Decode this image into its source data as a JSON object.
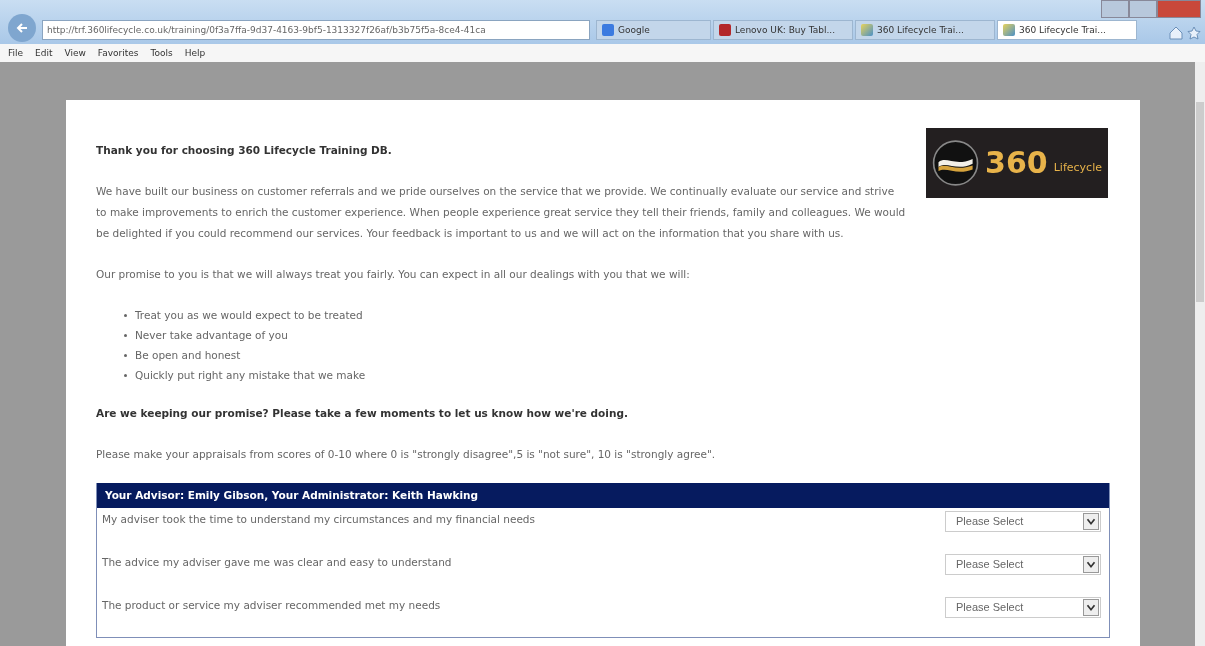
{
  "browser": {
    "address": "http://trf.360lifecycle.co.uk/training/0f3a7ffa-9d37-4163-9bf5-1313327f26af/b3b75f5a-8ce4-41ca",
    "tabs": [
      {
        "label": "Google",
        "selected": false,
        "kind": "google"
      },
      {
        "label": "Lenovo UK: Buy Tabl...",
        "selected": false,
        "kind": "lenovo"
      },
      {
        "label": "360 Lifecycle Trai...",
        "selected": false,
        "kind": "page"
      },
      {
        "label": "360 Lifecycle Trai...",
        "selected": true,
        "kind": "page"
      }
    ],
    "menu": [
      "File",
      "Edit",
      "View",
      "Favorites",
      "Tools",
      "Help"
    ]
  },
  "page": {
    "heading": "Thank you for choosing 360 Lifecycle Training DB.",
    "logo": {
      "number": "360",
      "word": "Lifecycle"
    },
    "intro": "We have built our business on customer referrals and we pride ourselves on the service that we provide. We continually evaluate our service and strive to make improvements to enrich the customer experience. When people experience great service they tell their friends, family and colleagues. We would be delighted if you could recommend our services. Your feedback is important to us and we will act on the information that you share with us.",
    "promise": "Our promise to you is that we will always treat you fairly. You can expect in all our dealings with you that we will:",
    "bullets": [
      "Treat you as we would expect to be treated",
      "Never take advantage of you",
      "Be open and honest",
      "Quickly put right any mistake that we make"
    ],
    "question": "Are we keeping our promise? Please take a few moments to let us know how we're doing.",
    "instructions": "Please make your appraisals from scores of 0-10 where 0 is \"strongly disagree\",5 is \"not sure\",  10 is \"strongly agree\".",
    "survey": {
      "header": "Your Advisor: Emily Gibson, Your Administrator: Keith Hawking",
      "rows": [
        {
          "statement": "My adviser took the time to understand my circumstances and my financial needs",
          "answer": "Please Select"
        },
        {
          "statement": "The advice my adviser gave me was clear and easy to understand",
          "answer": "Please Select"
        },
        {
          "statement": "The product or service my adviser recommended met my needs",
          "answer": "Please Select"
        }
      ]
    }
  }
}
